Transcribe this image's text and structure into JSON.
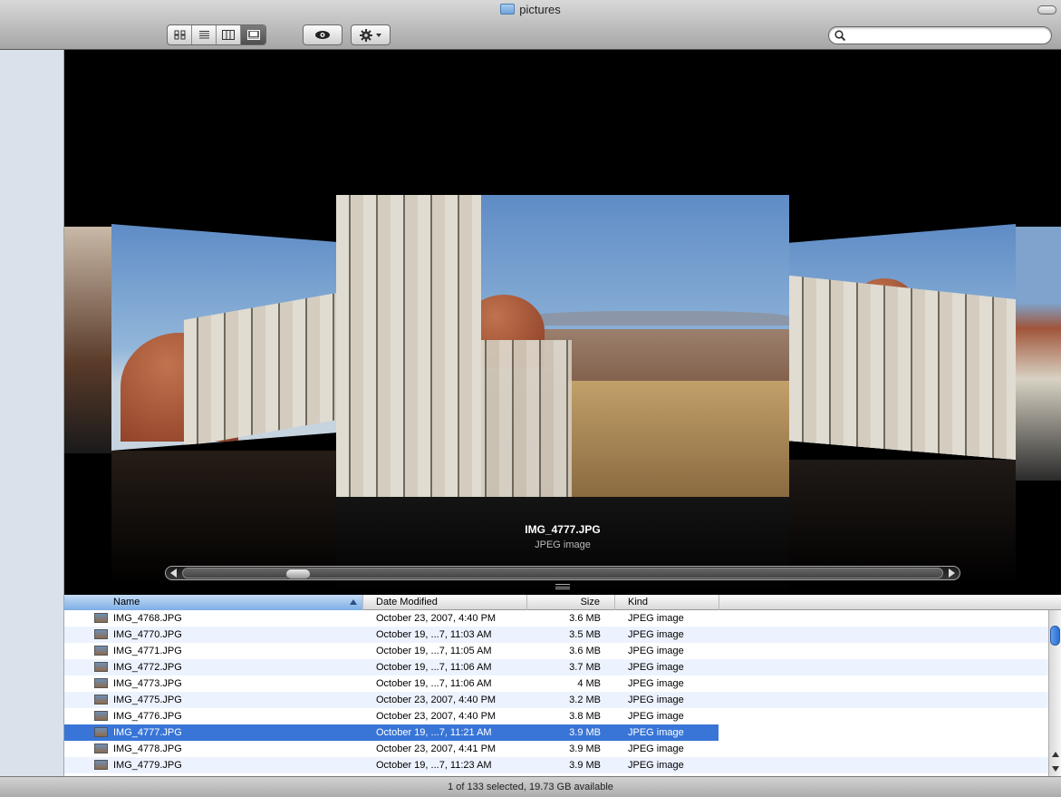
{
  "window": {
    "title": "pictures"
  },
  "toolbar": {
    "view_buttons": [
      {
        "icon": "icon-view-icon"
      },
      {
        "icon": "list-view-icon"
      },
      {
        "icon": "column-view-icon"
      },
      {
        "icon": "coverflow-view-icon",
        "active": true
      }
    ],
    "quicklook_icon": "eye-icon",
    "action_icon": "gear-icon",
    "search": {
      "placeholder": "",
      "value": ""
    }
  },
  "coverflow": {
    "selected_name": "IMG_4777.JPG",
    "selected_kind": "JPEG image",
    "scroll_position": 0.14
  },
  "list": {
    "columns": {
      "name": "Name",
      "date": "Date Modified",
      "size": "Size",
      "kind": "Kind"
    },
    "rows": [
      {
        "name": "IMG_4768.JPG",
        "date": "October 23, 2007, 4:40 PM",
        "size": "3.6 MB",
        "kind": "JPEG image"
      },
      {
        "name": "IMG_4770.JPG",
        "date": "October 19, ...7, 11:03 AM",
        "size": "3.5 MB",
        "kind": "JPEG image"
      },
      {
        "name": "IMG_4771.JPG",
        "date": "October 19, ...7, 11:05 AM",
        "size": "3.6 MB",
        "kind": "JPEG image"
      },
      {
        "name": "IMG_4772.JPG",
        "date": "October 19, ...7, 11:06 AM",
        "size": "3.7 MB",
        "kind": "JPEG image"
      },
      {
        "name": "IMG_4773.JPG",
        "date": "October 19, ...7, 11:06 AM",
        "size": "4 MB",
        "kind": "JPEG image"
      },
      {
        "name": "IMG_4775.JPG",
        "date": "October 23, 2007, 4:40 PM",
        "size": "3.2 MB",
        "kind": "JPEG image"
      },
      {
        "name": "IMG_4776.JPG",
        "date": "October 23, 2007, 4:40 PM",
        "size": "3.8 MB",
        "kind": "JPEG image"
      },
      {
        "name": "IMG_4777.JPG",
        "date": "October 19, ...7, 11:21 AM",
        "size": "3.9 MB",
        "kind": "JPEG image",
        "selected": true
      },
      {
        "name": "IMG_4778.JPG",
        "date": "October 23, 2007, 4:41 PM",
        "size": "3.9 MB",
        "kind": "JPEG image"
      },
      {
        "name": "IMG_4779.JPG",
        "date": "October 19, ...7, 11:23 AM",
        "size": "3.9 MB",
        "kind": "JPEG image"
      }
    ]
  },
  "status": {
    "text": "1 of 133 selected, 19.73 GB available"
  },
  "colors": {
    "selection": "#3875d7",
    "sidebar": "#d9e1ea"
  }
}
